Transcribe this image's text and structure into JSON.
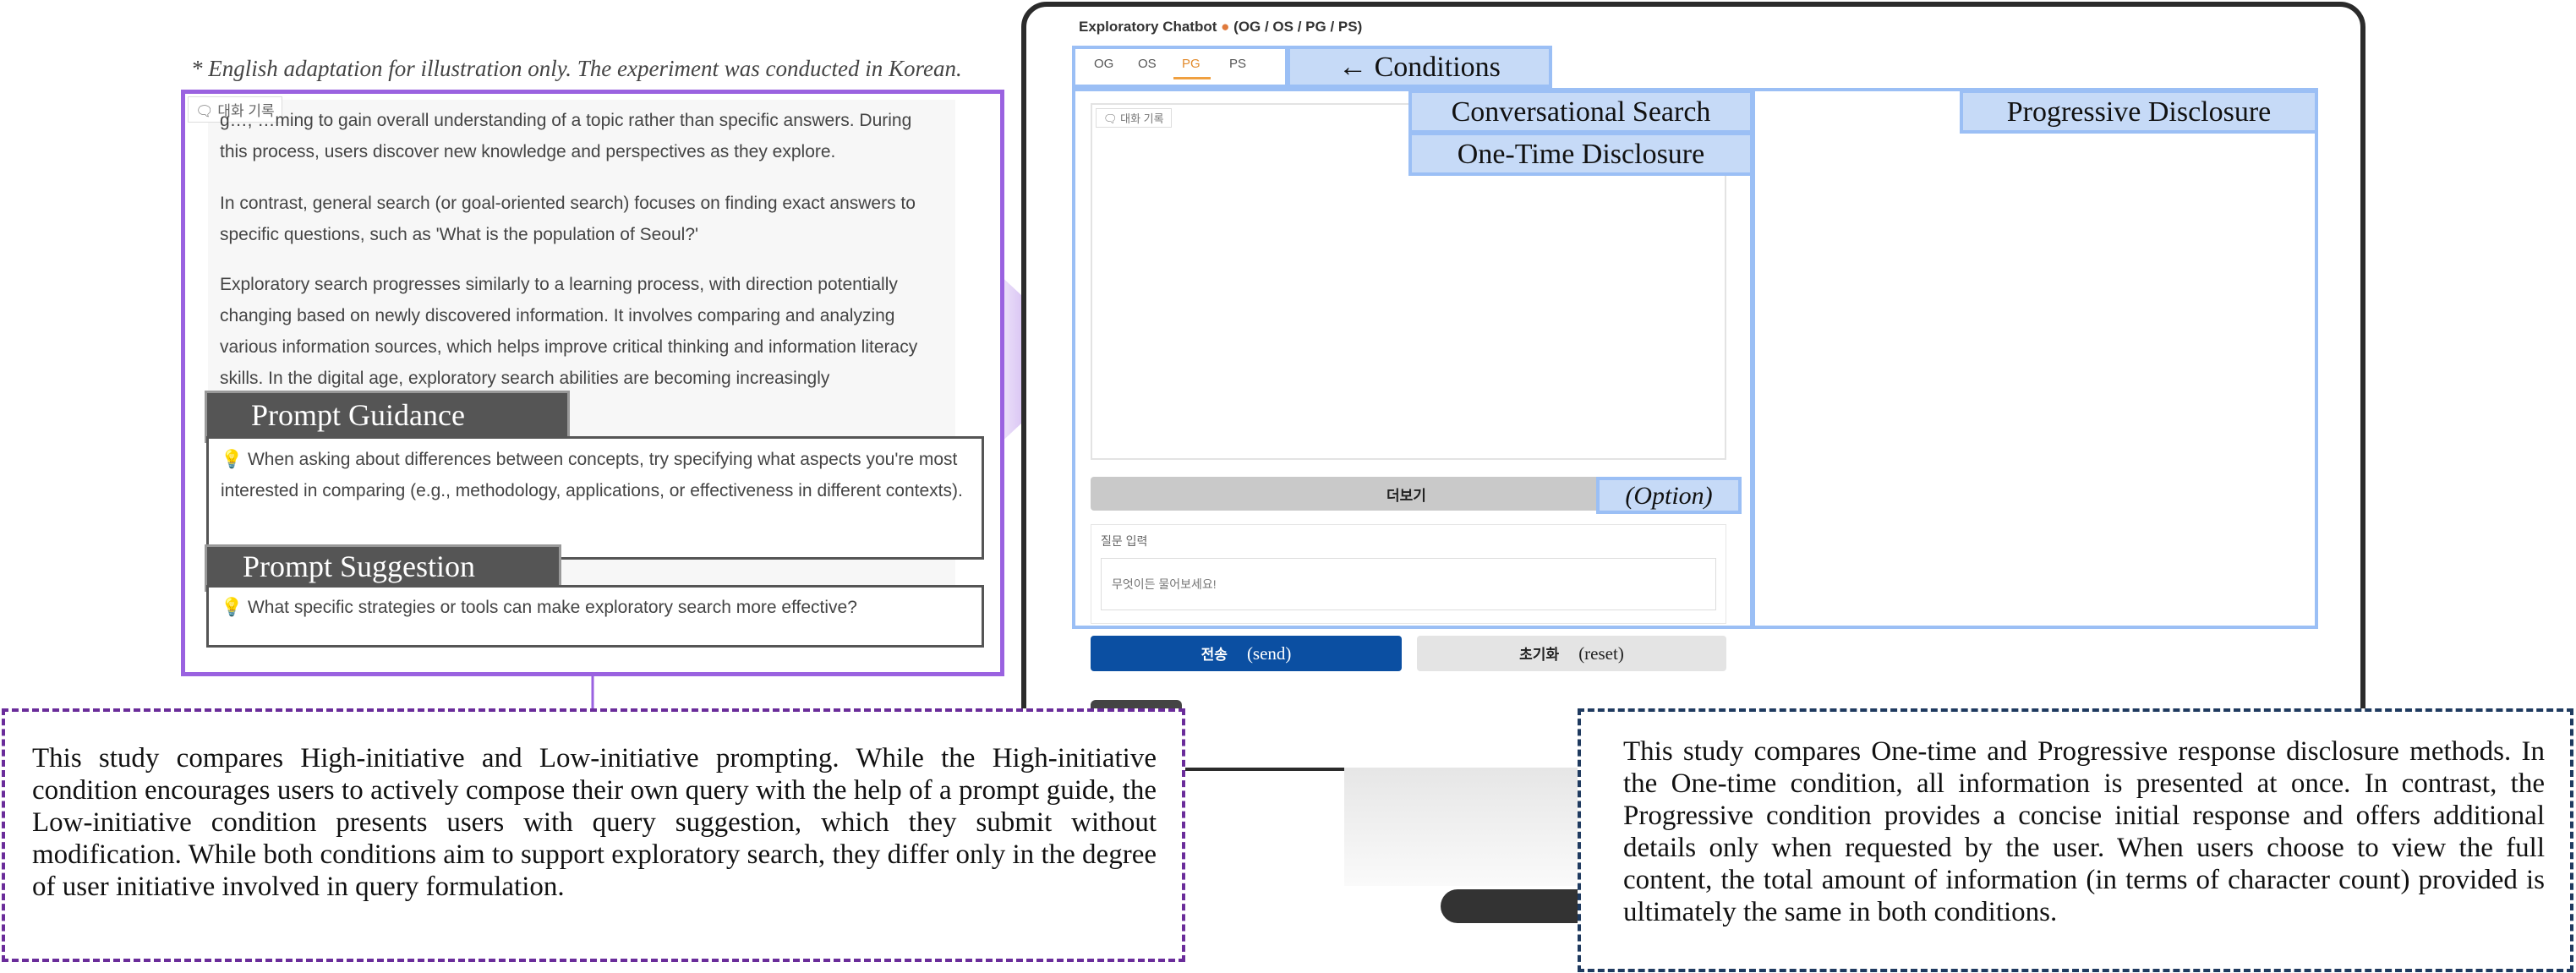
{
  "note": "* English adaptation for illustration only. The experiment was conducted in Korean.",
  "left_panel": {
    "history_chip": "대화 기록",
    "paragraphs": [
      "g…, …ming to gain overall understanding of a topic rather than specific answers. During this process, users discover new knowledge and perspectives as they explore.",
      "In contrast, general search (or goal-oriented search) focuses on finding exact answers to specific questions, such as 'What is the population of Seoul?'",
      "Exploratory search progresses similarly to a learning process, with direction potentially changing based on newly discovered information. It involves comparing and analyzing various information sources, which helps improve critical thinking and information literacy skills. In the digital age, exploratory search abilities are becoming increasingly"
    ],
    "prompt_guidance_label": "Prompt Guidance",
    "prompt_guidance_text": "💡 When asking about differences between concepts, try specifying what aspects you're most interested in comparing (e.g., methodology, applications, or effectiveness in different contexts).",
    "prompt_suggestion_label": "Prompt Suggestion",
    "prompt_suggestion_text": "💡 What specific strategies or tools can make exploratory search more effective?"
  },
  "app": {
    "title": "Exploratory Chatbot",
    "title_suffix": "(OG / OS / PG / PS)",
    "tabs": [
      {
        "label": "OG",
        "active": false
      },
      {
        "label": "OS",
        "active": false
      },
      {
        "label": "PG",
        "active": true
      },
      {
        "label": "PS",
        "active": false
      }
    ],
    "history_chip": "대화 기록",
    "more_button": "더보기",
    "question_label": "질문 입력",
    "question_placeholder": "무엇이든 물어보세요!",
    "send_button": "전송",
    "send_en": "(send)",
    "reset_button": "초기화",
    "reset_en": "(reset)"
  },
  "callouts": {
    "conditions": "← Conditions",
    "conversational_search": "Conversational Search",
    "one_time_disclosure": "One-Time Disclosure",
    "progressive_disclosure": "Progressive Disclosure",
    "option": "(Option)"
  },
  "descriptions": {
    "left": "This study compares High-initiative and Low-initiative prompting. While the High-initiative condition encourages users to actively compose their own query with the help of a prompt guide, the Low-initiative condition presents users with query suggestion, which they submit without modification. While both conditions aim to support exploratory search, they differ only in the degree of user initiative involved in query formulation.",
    "right": "This study compares One-time and Progressive response disclosure methods. In the One-time condition, all information is presented at once. In contrast, the Progressive condition provides a concise initial response and offers additional details only when requested by the user. When users choose to view the full content, the total amount of information (in terms of character count) provided is ultimately the same in both conditions."
  },
  "colors": {
    "purple_frame": "#9a62e0",
    "purple_dashed": "#6a2c9a",
    "navy_dashed": "#1f3a5f",
    "blue_outline": "#9bbff5",
    "blue_label": "#c6daf7",
    "send_button": "#0b4fa2",
    "pg_tab_accent": "#f0a040"
  }
}
